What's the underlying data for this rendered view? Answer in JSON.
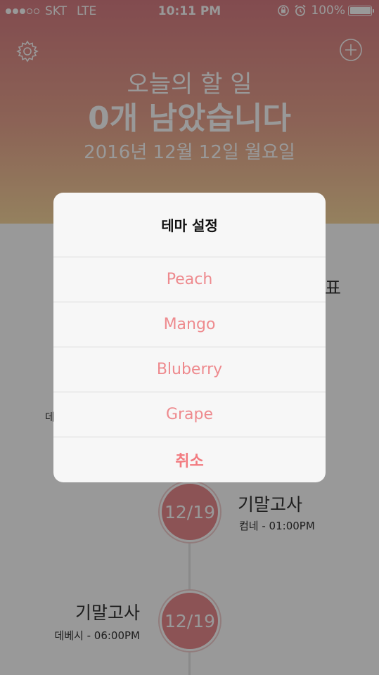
{
  "status_bar": {
    "carrier": "SKT",
    "network": "LTE",
    "time": "10:11 PM",
    "battery": "100%"
  },
  "header": {
    "subtitle": "오늘의 할 일",
    "title": "0개 남았습니다",
    "date": "2016년 12월 12일 월요일"
  },
  "timeline": {
    "fragment_right": "표",
    "fragment_left": "데",
    "events": [
      {
        "date": "12/19",
        "title": "기말고사",
        "detail": "컴네 - 01:00PM"
      },
      {
        "date": "12/19",
        "title": "기말고사",
        "detail": "데베시 - 06:00PM"
      }
    ]
  },
  "dialog": {
    "title": "테마 설정",
    "options": [
      "Peach",
      "Mango",
      "Bluberry",
      "Grape"
    ],
    "cancel": "취소"
  },
  "colors": {
    "accent": "#ee8a8e",
    "header_top": "#d97e84",
    "header_bottom": "#f8d79e",
    "event_circle": "#ea8a8e"
  }
}
